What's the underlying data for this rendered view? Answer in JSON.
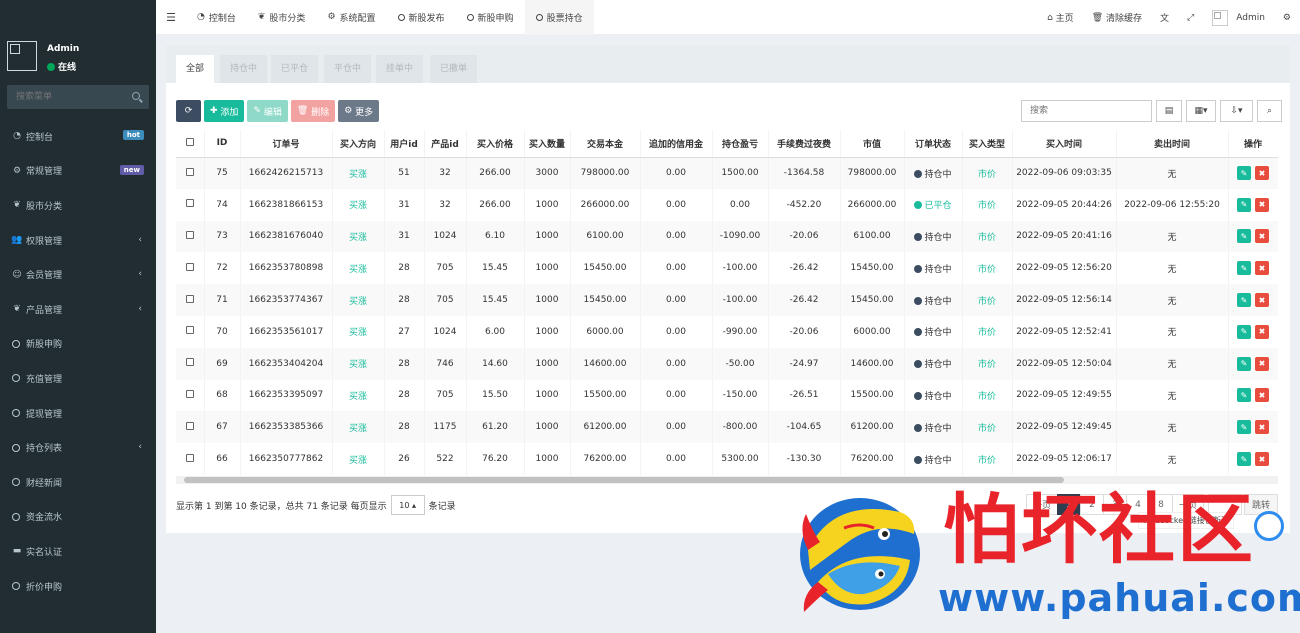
{
  "sidebar": {
    "user": {
      "name": "Admin",
      "status": "在线"
    },
    "search_placeholder": "搜索菜单",
    "items": [
      {
        "label": "控制台",
        "icon": "dashboard-icon",
        "badge": "hot"
      },
      {
        "label": "常规管理",
        "icon": "cogs-icon",
        "badge": "new"
      },
      {
        "label": "股市分类",
        "icon": "leaf-icon"
      },
      {
        "label": "权限管理",
        "icon": "group-icon",
        "chevron": true
      },
      {
        "label": "会员管理",
        "icon": "user-circle-icon",
        "chevron": true
      },
      {
        "label": "产品管理",
        "icon": "leaf-icon",
        "chevron": true
      },
      {
        "label": "新股申购",
        "icon": "circle-icon"
      },
      {
        "label": "充值管理",
        "icon": "circle-icon"
      },
      {
        "label": "提现管理",
        "icon": "circle-icon"
      },
      {
        "label": "持仓列表",
        "icon": "circle-icon",
        "chevron": true
      },
      {
        "label": "财经新闻",
        "icon": "circle-icon"
      },
      {
        "label": "资金流水",
        "icon": "circle-icon"
      },
      {
        "label": "实名认证",
        "icon": "id-card-icon"
      },
      {
        "label": "折价申购",
        "icon": "circle-icon"
      }
    ]
  },
  "navbar": {
    "tabs": [
      {
        "label": "控制台",
        "icon": "dashboard-icon"
      },
      {
        "label": "股市分类",
        "icon": "leaf-icon"
      },
      {
        "label": "系统配置",
        "icon": "cog-icon"
      },
      {
        "label": "新股发布",
        "icon": "circle-icon"
      },
      {
        "label": "新股申购",
        "icon": "circle-icon"
      },
      {
        "label": "股票持仓",
        "icon": "circle-icon",
        "active": true
      }
    ],
    "home": "主页",
    "clear_cache": "清除缓存",
    "admin": "Admin"
  },
  "filter_tabs": [
    "全部",
    "持仓中",
    "已平仓",
    "平仓中",
    "挂单中",
    "已撤单"
  ],
  "toolbar": {
    "add": "添加",
    "edit": "编辑",
    "delete": "删除",
    "more": "更多",
    "search_placeholder": "搜索"
  },
  "table": {
    "headers": [
      "ID",
      "订单号",
      "买入方向",
      "用户id",
      "产品id",
      "买入价格",
      "买入数量",
      "交易本金",
      "追加的信用金",
      "持仓盈亏",
      "手续费过夜费",
      "市值",
      "订单状态",
      "买入类型",
      "买入时间",
      "卖出时间",
      "操作"
    ],
    "rows": [
      {
        "id": "75",
        "order": "1662426215713",
        "dir": "买涨",
        "uid": "51",
        "pid": "32",
        "price": "266.00",
        "qty": "3000",
        "principal": "798000.00",
        "credit": "0.00",
        "pnl": "1500.00",
        "fee": "-1364.58",
        "mv": "798000.00",
        "status": "持仓中",
        "status_color": "#3c4d62",
        "type": "市价",
        "buy_time": "2022-09-06 09:03:35",
        "sell_time": "无"
      },
      {
        "id": "74",
        "order": "1662381866153",
        "dir": "买涨",
        "uid": "31",
        "pid": "32",
        "price": "266.00",
        "qty": "1000",
        "principal": "266000.00",
        "credit": "0.00",
        "pnl": "0.00",
        "fee": "-452.20",
        "mv": "266000.00",
        "status": "已平仓",
        "status_color": "#18bc9c",
        "type": "市价",
        "buy_time": "2022-09-05 20:44:26",
        "sell_time": "2022-09-06 12:55:20"
      },
      {
        "id": "73",
        "order": "1662381676040",
        "dir": "买涨",
        "uid": "31",
        "pid": "1024",
        "price": "6.10",
        "qty": "1000",
        "principal": "6100.00",
        "credit": "0.00",
        "pnl": "-1090.00",
        "fee": "-20.06",
        "mv": "6100.00",
        "status": "持仓中",
        "status_color": "#3c4d62",
        "type": "市价",
        "buy_time": "2022-09-05 20:41:16",
        "sell_time": "无"
      },
      {
        "id": "72",
        "order": "1662353780898",
        "dir": "买涨",
        "uid": "28",
        "pid": "705",
        "price": "15.45",
        "qty": "1000",
        "principal": "15450.00",
        "credit": "0.00",
        "pnl": "-100.00",
        "fee": "-26.42",
        "mv": "15450.00",
        "status": "持仓中",
        "status_color": "#3c4d62",
        "type": "市价",
        "buy_time": "2022-09-05 12:56:20",
        "sell_time": "无"
      },
      {
        "id": "71",
        "order": "1662353774367",
        "dir": "买涨",
        "uid": "28",
        "pid": "705",
        "price": "15.45",
        "qty": "1000",
        "principal": "15450.00",
        "credit": "0.00",
        "pnl": "-100.00",
        "fee": "-26.42",
        "mv": "15450.00",
        "status": "持仓中",
        "status_color": "#3c4d62",
        "type": "市价",
        "buy_time": "2022-09-05 12:56:14",
        "sell_time": "无"
      },
      {
        "id": "70",
        "order": "1662353561017",
        "dir": "买涨",
        "uid": "27",
        "pid": "1024",
        "price": "6.00",
        "qty": "1000",
        "principal": "6000.00",
        "credit": "0.00",
        "pnl": "-990.00",
        "fee": "-20.06",
        "mv": "6000.00",
        "status": "持仓中",
        "status_color": "#3c4d62",
        "type": "市价",
        "buy_time": "2022-09-05 12:52:41",
        "sell_time": "无"
      },
      {
        "id": "69",
        "order": "1662353404204",
        "dir": "买涨",
        "uid": "28",
        "pid": "746",
        "price": "14.60",
        "qty": "1000",
        "principal": "14600.00",
        "credit": "0.00",
        "pnl": "-50.00",
        "fee": "-24.97",
        "mv": "14600.00",
        "status": "持仓中",
        "status_color": "#3c4d62",
        "type": "市价",
        "buy_time": "2022-09-05 12:50:04",
        "sell_time": "无"
      },
      {
        "id": "68",
        "order": "1662353395097",
        "dir": "买涨",
        "uid": "28",
        "pid": "705",
        "price": "15.50",
        "qty": "1000",
        "principal": "15500.00",
        "credit": "0.00",
        "pnl": "-150.00",
        "fee": "-26.51",
        "mv": "15500.00",
        "status": "持仓中",
        "status_color": "#3c4d62",
        "type": "市价",
        "buy_time": "2022-09-05 12:49:55",
        "sell_time": "无"
      },
      {
        "id": "67",
        "order": "1662353385366",
        "dir": "买涨",
        "uid": "28",
        "pid": "1175",
        "price": "61.20",
        "qty": "1000",
        "principal": "61200.00",
        "credit": "0.00",
        "pnl": "-800.00",
        "fee": "-104.65",
        "mv": "61200.00",
        "status": "持仓中",
        "status_color": "#3c4d62",
        "type": "市价",
        "buy_time": "2022-09-05 12:49:45",
        "sell_time": "无"
      },
      {
        "id": "66",
        "order": "1662350777862",
        "dir": "买涨",
        "uid": "26",
        "pid": "522",
        "price": "76.20",
        "qty": "1000",
        "principal": "76200.00",
        "credit": "0.00",
        "pnl": "5300.00",
        "fee": "-130.30",
        "mv": "76200.00",
        "status": "持仓中",
        "status_color": "#3c4d62",
        "type": "市价",
        "buy_time": "2022-09-05 12:06:17",
        "sell_time": "无"
      }
    ]
  },
  "footer": {
    "info_prefix": "显示第 1 到第 10 条记录，总共 71 条记录 每页显示",
    "page_size": "10",
    "info_suffix": "条记录"
  },
  "pager": {
    "prev": "一页",
    "pages": [
      "1",
      "2",
      "3",
      "4",
      "8"
    ],
    "ellipsis": "",
    "next": "一页",
    "jump": "跳转"
  },
  "websocket_tip": "Websocket 链接已断开",
  "watermark": {
    "title": "怕坏社区",
    "url": "www.pahuai.com"
  },
  "colors": {
    "sidebar_bg": "#222d32",
    "accent_green": "#18bc9c",
    "danger": "#e74c3c",
    "primary_dark": "#2c3e50"
  }
}
